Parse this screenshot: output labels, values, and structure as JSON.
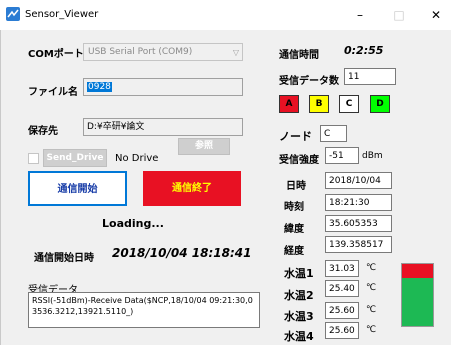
{
  "window": {
    "title": "Sensor_Viewer",
    "minimize": "–",
    "maximize": "□",
    "close": "✕"
  },
  "left": {
    "com_label": "COMポート",
    "com_value": "USB Serial Port (COM9)",
    "file_label": "ファイル名",
    "file_value": "0928",
    "save_label": "保存先",
    "save_value": "D:¥卒研¥論文",
    "browse_label": "参照",
    "send_drive_label": "Send_Drive",
    "no_drive": "No Drive",
    "start_label": "通信開始",
    "stop_label": "通信終了",
    "loading": "Loading...",
    "start_time_label": "通信開始日時",
    "start_time_value": "2018/10/04 18:18:41",
    "recv_label": "受信データ",
    "recv_text": "RSSI(-51dBm)-Receive Data($NCP,18/10/04 09:21:30,03536.3212,13921.5110_)"
  },
  "right": {
    "comm_time_label": "通信時間",
    "comm_time_value": "0:2:55",
    "recv_count_label": "受信データ数",
    "recv_count_value": "11",
    "color_buttons": [
      {
        "label": "A",
        "color": "#e81123"
      },
      {
        "label": "B",
        "color": "#ffff00"
      },
      {
        "label": "C",
        "color": "#ffffff"
      },
      {
        "label": "D",
        "color": "#00ff00"
      }
    ],
    "node_label": "ノード",
    "node_value": "C",
    "rssi_label": "受信強度",
    "rssi_value": "-51",
    "rssi_unit": "dBm",
    "date_label": "日時",
    "date_value": "2018/10/04",
    "time_label": "時刻",
    "time_value": "18:21:30",
    "lat_label": "緯度",
    "lat_value": "35.605353",
    "lon_label": "経度",
    "lon_value": "139.358517",
    "water": [
      {
        "label": "水温1",
        "value": "31.03",
        "unit": "℃"
      },
      {
        "label": "水温2",
        "value": "25.40",
        "unit": "℃"
      },
      {
        "label": "水温3",
        "value": "25.60",
        "unit": "℃"
      },
      {
        "label": "水温4",
        "value": "25.60",
        "unit": "℃"
      }
    ],
    "level": {
      "top_color": "#e81123",
      "bottom_color": "#1db954",
      "top_fraction": 0.22
    }
  }
}
